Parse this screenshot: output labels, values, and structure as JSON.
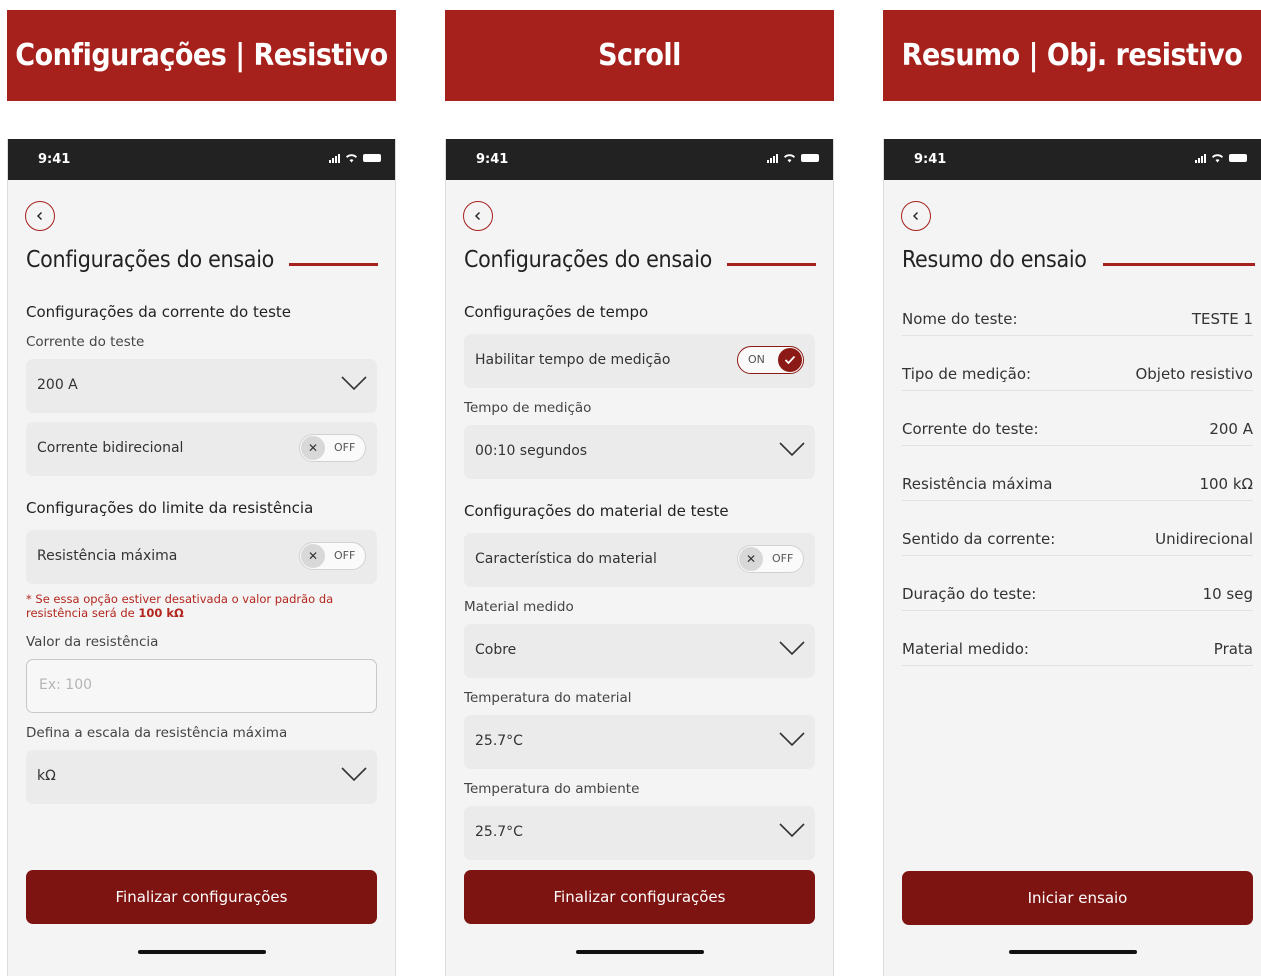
{
  "screens": [
    {
      "banner": "Configurações | Resistivo",
      "status_time": "9:41",
      "title": "Configurações do ensaio",
      "current_section": "Configurações da corrente do teste",
      "current_label": "Corrente do teste",
      "current_value": "200 A",
      "bidirectional_label": "Corrente bidirecional",
      "bidirectional_state": "OFF",
      "limit_section": "Configurações do limite da resistência",
      "max_res_label": "Resistência máxima",
      "max_res_state": "OFF",
      "note_prefix": "* Se essa opção estiver desativada o valor padrão da resistência será de ",
      "note_value": "100 kΩ",
      "res_value_label": "Valor da resistência",
      "res_value_placeholder": "Ex: 100",
      "scale_label": "Defina a escala da resistência máxima",
      "scale_value": "kΩ",
      "button": "Finalizar configurações"
    },
    {
      "banner": "Scroll",
      "status_time": "9:41",
      "title": "Configurações do ensaio",
      "time_section": "Configurações de tempo",
      "enable_time_label": "Habilitar tempo de medição",
      "enable_time_state": "ON",
      "measure_time_label": "Tempo de medição",
      "measure_time_value": "00:10 segundos",
      "material_section": "Configurações do material de teste",
      "material_char_label": "Característica do material",
      "material_char_state": "OFF",
      "material_label": "Material medido",
      "material_value": "Cobre",
      "mat_temp_label": "Temperatura do material",
      "mat_temp_value": "25.7°C",
      "amb_temp_label": "Temperatura do ambiente",
      "amb_temp_value": "25.7°C",
      "button": "Finalizar configurações"
    },
    {
      "banner": "Resumo | Obj. resistivo",
      "status_time": "9:41",
      "title": "Resumo do ensaio",
      "rows": [
        {
          "key": "Nome do teste:",
          "value": "TESTE 1"
        },
        {
          "key": "Tipo de medição:",
          "value": "Objeto resistivo"
        },
        {
          "key": "Corrente do teste:",
          "value": "200 A"
        },
        {
          "key": "Resistência máxima",
          "value": "100 kΩ"
        },
        {
          "key": "Sentido da corrente:",
          "value": "Unidirecional"
        },
        {
          "key": "Duração do teste:",
          "value": "10 seg"
        },
        {
          "key": "Material medido:",
          "value": "Prata"
        }
      ],
      "button": "Iniciar ensaio"
    }
  ],
  "colors": {
    "brand_red": "#a6201c",
    "button_dark_red": "#7d1411",
    "note_red": "#b3261e"
  }
}
